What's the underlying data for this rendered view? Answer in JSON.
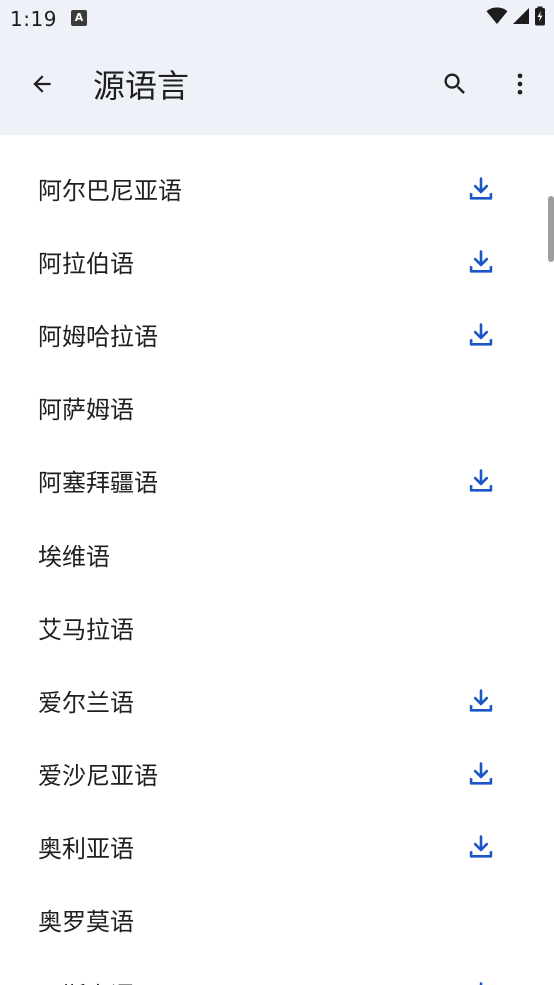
{
  "status_bar": {
    "time": "1:19",
    "notification_glyph": "A",
    "icons": [
      "wifi-icon",
      "cell-signal-icon",
      "battery-charging-icon"
    ]
  },
  "app_bar": {
    "title": "源语言",
    "back_icon": "arrow-back-icon",
    "search_icon": "search-icon",
    "more_icon": "more-vert-icon"
  },
  "colors": {
    "header_bg": "#eef1f8",
    "download_accent": "#1a56c8",
    "text_primary": "#1f1f1f",
    "scrollbar": "#9e9e9e"
  },
  "languages": [
    {
      "name": "阿尔巴尼亚语",
      "downloadable": true
    },
    {
      "name": "阿拉伯语",
      "downloadable": true
    },
    {
      "name": "阿姆哈拉语",
      "downloadable": true
    },
    {
      "name": "阿萨姆语",
      "downloadable": false
    },
    {
      "name": "阿塞拜疆语",
      "downloadable": true
    },
    {
      "name": "埃维语",
      "downloadable": false
    },
    {
      "name": "艾马拉语",
      "downloadable": false
    },
    {
      "name": "爱尔兰语",
      "downloadable": true
    },
    {
      "name": "爱沙尼亚语",
      "downloadable": true
    },
    {
      "name": "奥利亚语",
      "downloadable": true
    },
    {
      "name": "奥罗莫语",
      "downloadable": false
    },
    {
      "name": "巴斯克语",
      "downloadable": true
    }
  ]
}
